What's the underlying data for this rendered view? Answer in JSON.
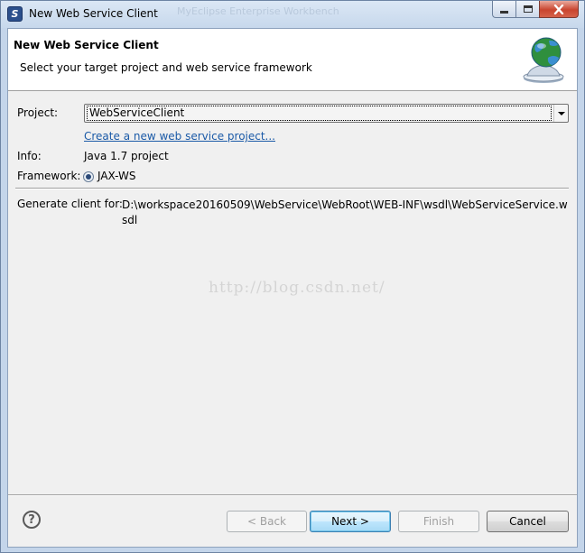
{
  "window": {
    "title": "New Web Service Client",
    "background_title": "MyEclipse Enterprise Workbench",
    "accent": "#c4d5ea"
  },
  "banner": {
    "title": "New Web Service Client",
    "subtitle": "Select your target project and web service framework",
    "icon": "web-service-globe-icon"
  },
  "form": {
    "project_label": "Project:",
    "project_value": "WebServiceClient",
    "create_link": "Create a new web service project...",
    "info_label": "Info:",
    "info_value": "Java 1.7 project",
    "framework_label": "Framework:",
    "framework_option": "JAX-WS",
    "framework_selected": true,
    "generate_label": "Generate client for:",
    "generate_path": "D:\\workspace20160509\\WebService\\WebRoot\\WEB-INF\\wsdl\\WebServiceService.wsdl"
  },
  "watermark": "http://blog.csdn.net/",
  "buttons": {
    "help": "?",
    "back": "< Back",
    "back_enabled": false,
    "next": "Next >",
    "next_enabled": true,
    "finish": "Finish",
    "finish_enabled": false,
    "cancel": "Cancel"
  }
}
